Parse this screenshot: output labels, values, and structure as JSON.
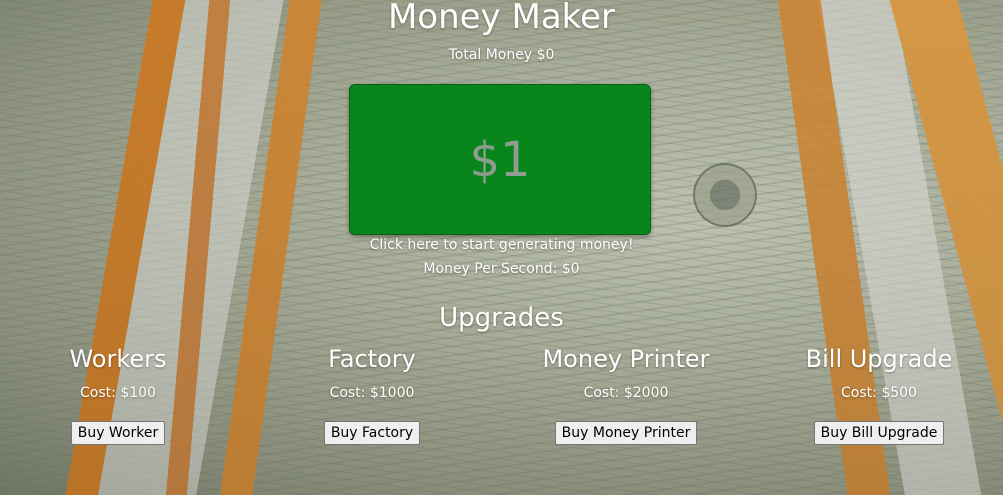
{
  "header": {
    "title": "Money Maker",
    "total_money": "Total Money $0"
  },
  "main": {
    "money_button_label": "$1",
    "hint": "Click here to start generating money!",
    "money_per_second": "Money Per Second: $0"
  },
  "upgrades": {
    "title": "Upgrades",
    "items": [
      {
        "name": "Workers",
        "cost": "Cost: $100",
        "button": "Buy Worker"
      },
      {
        "name": "Factory",
        "cost": "Cost: $1000",
        "button": "Buy Factory"
      },
      {
        "name": "Money Printer",
        "cost": "Cost: $2000",
        "button": "Buy Money Printer"
      },
      {
        "name": "Bill Upgrade",
        "cost": "Cost: $500",
        "button": "Buy Bill Upgrade"
      }
    ]
  },
  "colors": {
    "money_button": "#08861c",
    "text": "#ffffff"
  }
}
